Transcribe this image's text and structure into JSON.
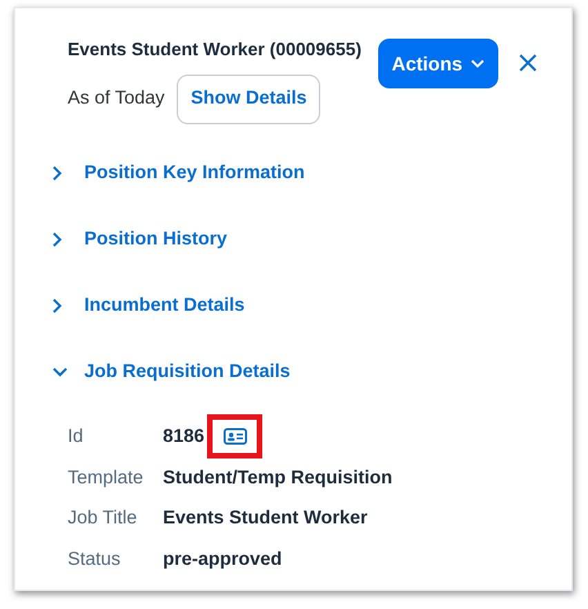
{
  "header": {
    "title": "Events Student Worker (00009655)",
    "as_of": "As of Today",
    "show_details_button": "Show Details",
    "actions_button": "Actions"
  },
  "sections": [
    {
      "label": "Position Key Information",
      "expanded": false
    },
    {
      "label": "Position History",
      "expanded": false
    },
    {
      "label": "Incumbent Details",
      "expanded": false
    },
    {
      "label": "Job Requisition Details",
      "expanded": true
    }
  ],
  "details": [
    {
      "label": "Id",
      "value": "8186",
      "kind": "id",
      "highlighted": true
    },
    {
      "label": "Template",
      "value": "Student/Temp Requisition",
      "kind": "text"
    },
    {
      "label": "Job Title",
      "value": "Events Student Worker",
      "kind": "text"
    },
    {
      "label": "Status",
      "value": "pre-approved",
      "kind": "text"
    }
  ]
}
